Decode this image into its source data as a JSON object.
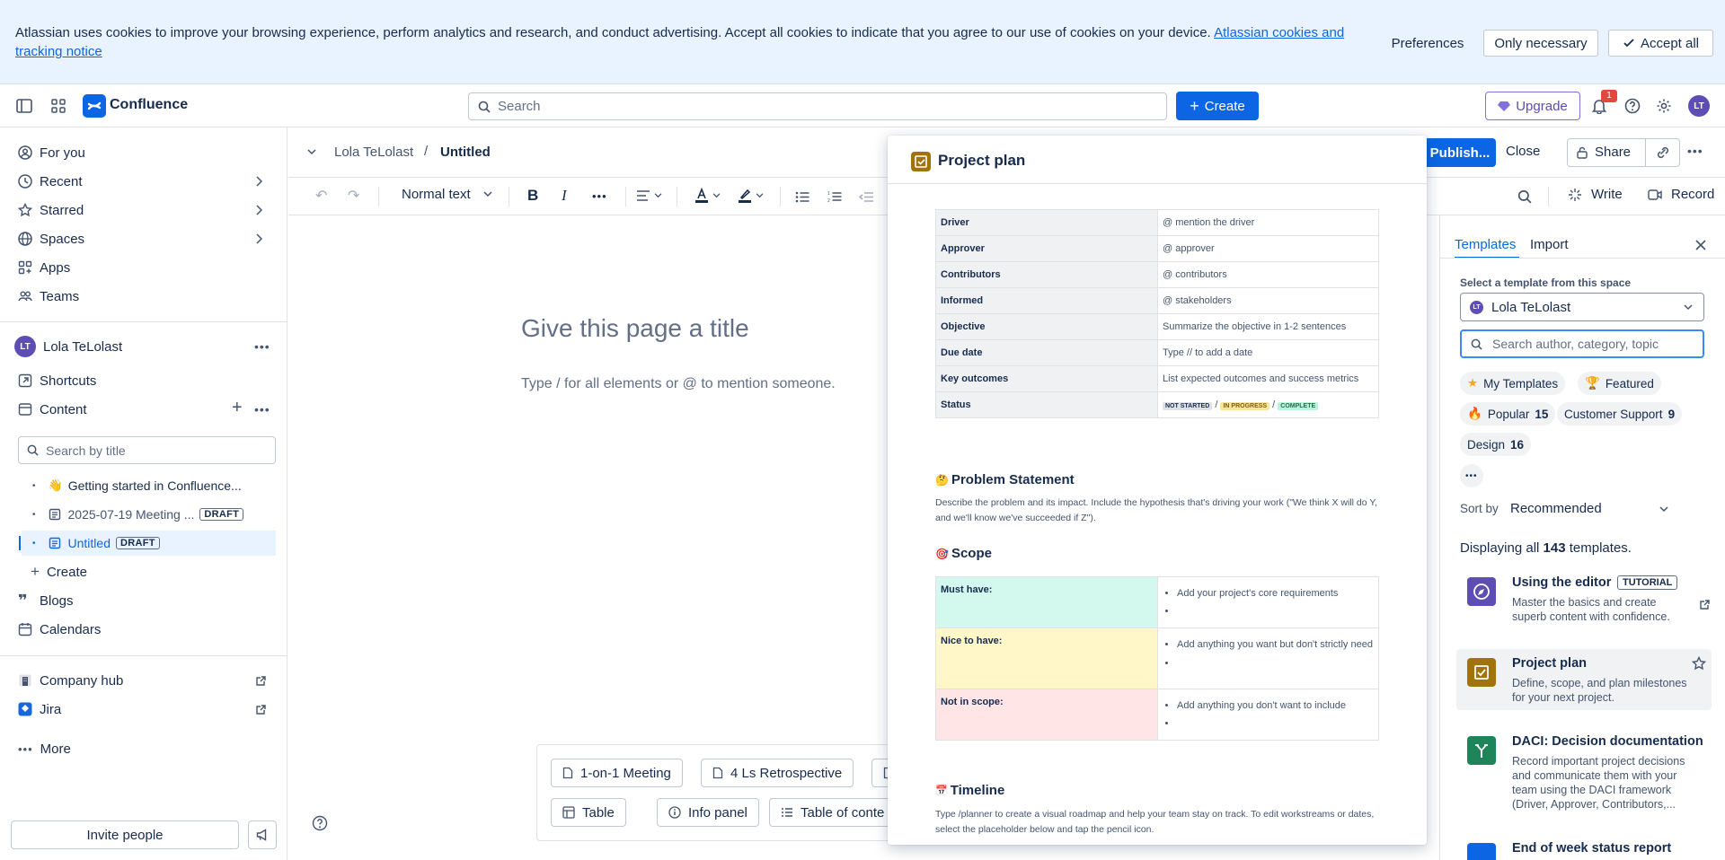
{
  "cookie": {
    "text": "Atlassian uses cookies to improve your browsing experience, perform analytics and research, and conduct advertising. Accept all cookies to indicate that you agree to our use of cookies on your device.",
    "link": "Atlassian cookies and tracking notice",
    "preferences": "Preferences",
    "only_necessary": "Only necessary",
    "accept_all": "Accept all"
  },
  "topnav": {
    "brand": "Confluence",
    "search_placeholder": "Search",
    "create": "Create",
    "upgrade": "Upgrade",
    "notif_count": "1",
    "avatar": "LT"
  },
  "sidebar": {
    "for_you": "For you",
    "recent": "Recent",
    "starred": "Starred",
    "spaces": "Spaces",
    "apps": "Apps",
    "teams": "Teams",
    "space_name": "Lola TeLolast",
    "space_avatar": "LT",
    "shortcuts": "Shortcuts",
    "content": "Content",
    "search_placeholder": "Search by title",
    "tree": [
      {
        "label": "Getting started in Confluence...",
        "tag": ""
      },
      {
        "label": "2025-07-19 Meeting ...",
        "tag": "DRAFT"
      },
      {
        "label": "Untitled",
        "tag": "DRAFT"
      }
    ],
    "create": "Create",
    "blogs": "Blogs",
    "calendars": "Calendars",
    "company_hub": "Company hub",
    "jira": "Jira",
    "more": "More",
    "invite": "Invite people"
  },
  "editor": {
    "breadcrumb_space": "Lola TeLolast",
    "breadcrumb_sep": "/",
    "breadcrumb_page": "Untitled",
    "publish": "Publish...",
    "close": "Close",
    "share": "Share",
    "text_style": "Normal text",
    "write": "Write",
    "record": "Record",
    "title_placeholder": "Give this page a title",
    "body_placeholder": "Type / for all elements or @ to mention someone.",
    "chips_row1": [
      "1-on-1 Meeting",
      "4 Ls Retrospective"
    ],
    "chips_row2": [
      "Table",
      "Info panel",
      "Table of conte"
    ]
  },
  "preview": {
    "title": "Project plan",
    "rows": [
      {
        "k": "Driver",
        "v": "@ mention the driver"
      },
      {
        "k": "Approver",
        "v": "@ approver"
      },
      {
        "k": "Contributors",
        "v": "@ contributors"
      },
      {
        "k": "Informed",
        "v": "@ stakeholders"
      },
      {
        "k": "Objective",
        "v": "Summarize the objective in 1-2 sentences"
      },
      {
        "k": "Due date",
        "v": "Type // to add a date"
      },
      {
        "k": "Key outcomes",
        "v": "List expected outcomes and success metrics"
      }
    ],
    "status_label": "Status",
    "status_not_started": "NOT STARTED",
    "status_in_progress": "IN PROGRESS",
    "status_complete": "COMPLETE",
    "status_sep": "/",
    "problem_heading": "Problem Statement",
    "problem_text": "Describe the problem and its impact. Include the hypothesis that's driving your work (\"We think X will do Y, and we'll know we've succeeded if Z\").",
    "scope_heading": "Scope",
    "scope": [
      {
        "k": "Must have:",
        "v": "Add your project's core requirements",
        "bg": "#d3f8ee"
      },
      {
        "k": "Nice to have:",
        "v": "Add anything you want but don't strictly need",
        "bg": "#fff7c8"
      },
      {
        "k": "Not in scope:",
        "v": "Add anything you don't want to include",
        "bg": "#ffe5e5"
      }
    ],
    "timeline_heading": "Timeline",
    "timeline_text": "Type /planner to create a visual roadmap and help your team stay on track. To edit workstreams or dates, select the placeholder below and tap the pencil icon."
  },
  "panel": {
    "tab_templates": "Templates",
    "tab_import": "Import",
    "select_label": "Select a template from this space",
    "space_select": "Lola TeLolast",
    "space_avatar": "LT",
    "search_placeholder": "Search author, category, topic",
    "tags": [
      {
        "label": "My Templates",
        "count": ""
      },
      {
        "label": "Featured",
        "count": ""
      },
      {
        "label": "Popular",
        "count": "15"
      },
      {
        "label": "Customer Support",
        "count": "9"
      },
      {
        "label": "Design",
        "count": "16"
      }
    ],
    "more_tags": "•••",
    "sort_label": "Sort by",
    "sort_value": "Recommended",
    "displaying_prefix": "Displaying all",
    "displaying_count": "143",
    "displaying_suffix": "templates.",
    "templates": [
      {
        "title": "Using the editor",
        "badge": "TUTORIAL",
        "desc": "Master the basics and create superb content with confidence.",
        "color": "#5e4db2"
      },
      {
        "title": "Project plan",
        "badge": "",
        "desc": "Define, scope, and plan milestones for your next project.",
        "color": "#a0730c"
      },
      {
        "title": "DACI: Decision documentation",
        "badge": "",
        "desc": "Record important project decisions and communicate them with your team using the DACI framework (Driver, Approver, Contributors,...",
        "color": "#1f845a"
      },
      {
        "title": "End of week status report",
        "badge": "",
        "desc": "",
        "color": "#0c66e4"
      }
    ]
  }
}
